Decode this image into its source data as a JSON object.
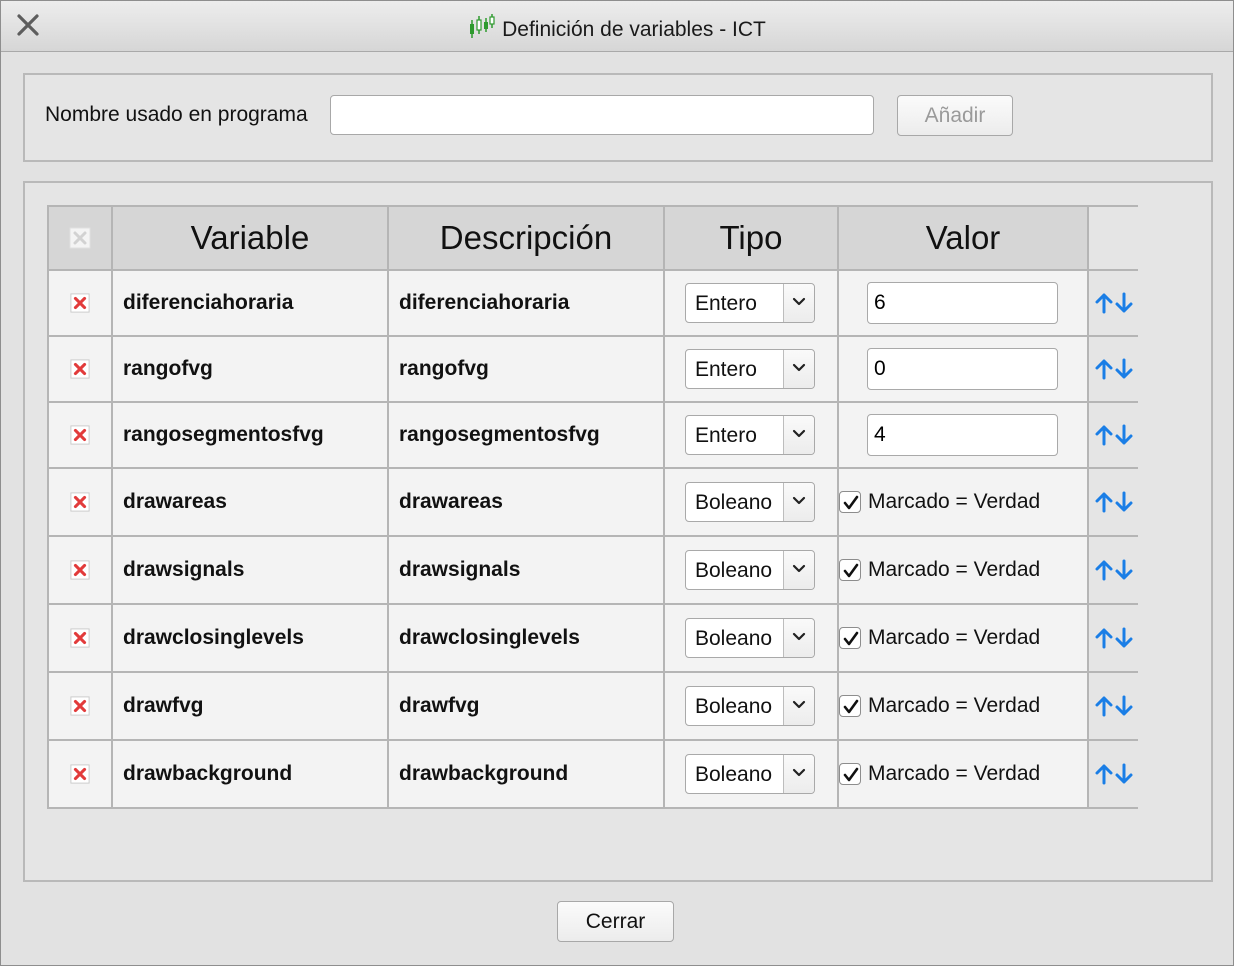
{
  "window": {
    "title": "Definición de variables - ICT"
  },
  "top_panel": {
    "name_label": "Nombre usado en programa",
    "name_value": "",
    "add_button": "Añadir"
  },
  "table": {
    "headers": {
      "variable": "Variable",
      "description": "Descripción",
      "type": "Tipo",
      "value": "Valor"
    },
    "rows": [
      {
        "variable": "diferenciahoraria",
        "description": "diferenciahoraria",
        "type": "Entero",
        "value": "6"
      },
      {
        "variable": "rangofvg",
        "description": "rangofvg",
        "type": "Entero",
        "value": "0"
      },
      {
        "variable": "rangosegmentosfvg",
        "description": "rangosegmentosfvg",
        "type": "Entero",
        "value": "4"
      },
      {
        "variable": "drawareas",
        "description": "drawareas",
        "type": "Boleano",
        "checked": true,
        "check_label": "Marcado = Verdad"
      },
      {
        "variable": "drawsignals",
        "description": "drawsignals",
        "type": "Boleano",
        "checked": true,
        "check_label": "Marcado = Verdad"
      },
      {
        "variable": "drawclosinglevels",
        "description": "drawclosinglevels",
        "type": "Boleano",
        "checked": true,
        "check_label": "Marcado = Verdad"
      },
      {
        "variable": "drawfvg",
        "description": "drawfvg",
        "type": "Boleano",
        "checked": true,
        "check_label": "Marcado = Verdad"
      },
      {
        "variable": "drawbackground",
        "description": "drawbackground",
        "type": "Boleano",
        "checked": true,
        "check_label": "Marcado = Verdad"
      }
    ]
  },
  "footer": {
    "close_button": "Cerrar"
  },
  "icons": {
    "close": "close-icon",
    "app": "candlestick-chart-icon",
    "delete_row": "delete-icon",
    "dropdown": "chevron-down-icon",
    "move_up": "arrow-up-icon",
    "move_down": "arrow-down-icon",
    "checkmark": "checkmark-icon"
  },
  "colors": {
    "delete_red": "#e23b3b",
    "arrow_blue": "#1a7ee6",
    "candle_green": "#2e9a2e"
  }
}
